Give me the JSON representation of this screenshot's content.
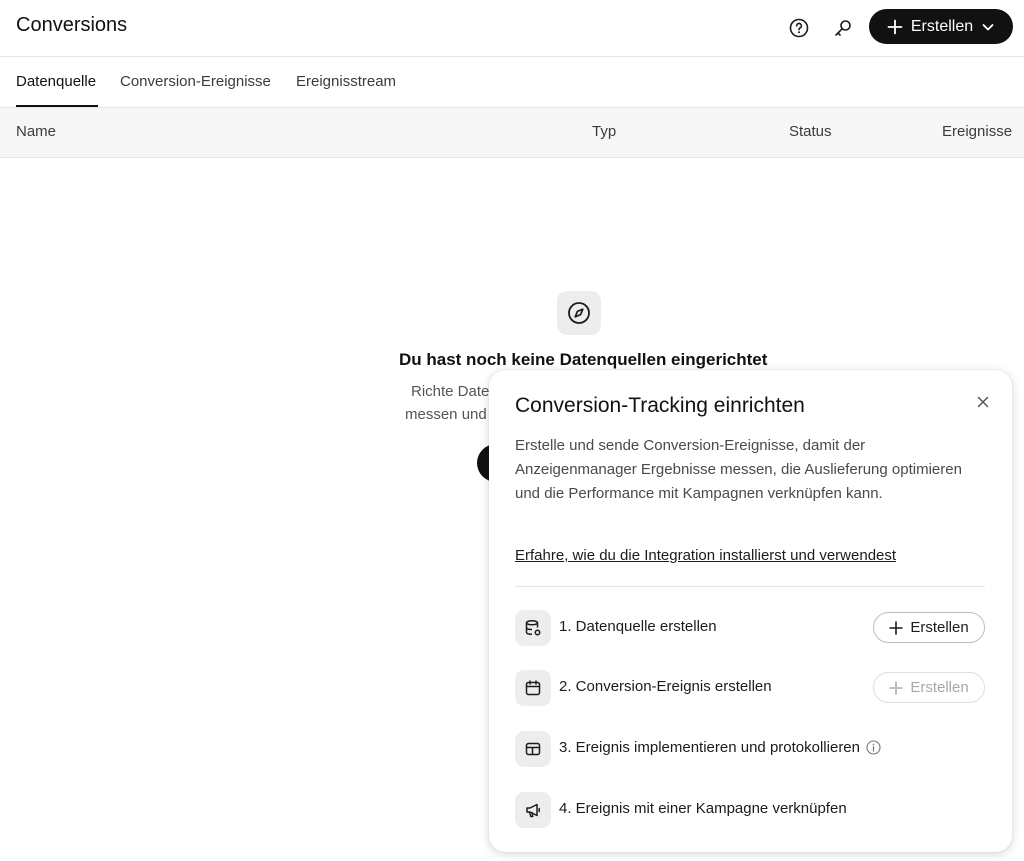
{
  "header": {
    "title": "Conversions",
    "help_icon": "help-circle-icon",
    "settings_icon": "key-icon",
    "create_label": "Erstellen"
  },
  "tabs": [
    {
      "label": "Datenquelle",
      "active": true
    },
    {
      "label": "Conversion-Ereignisse",
      "active": false
    },
    {
      "label": "Ereignisstream",
      "active": false
    }
  ],
  "table": {
    "columns": [
      "Name",
      "Typ",
      "Status",
      "Ereignisse"
    ]
  },
  "empty_state": {
    "icon": "compass-icon",
    "title": "Du hast noch keine Datenquellen eingerichtet",
    "desc_line1": "Richte Date",
    "desc_line2": "messen und"
  },
  "panel": {
    "title": "Conversion-Tracking einrichten",
    "description": "Erstelle und sende Conversion-Ereignisse, damit der Anzeigenmanager Ergebnisse messen, die Auslieferung optimieren und die Performance mit Kampagnen verknüpfen kann.",
    "link": "Erfahre, wie du die Integration installierst und verwendest",
    "steps": [
      {
        "label": "1. Datenquelle erstellen",
        "icon": "database-settings-icon",
        "button": "Erstellen",
        "enabled": true
      },
      {
        "label": "2. Conversion-Ereignis erstellen",
        "icon": "calendar-icon",
        "button": "Erstellen",
        "enabled": false
      },
      {
        "label": "3. Ereignis implementieren und protokollieren",
        "icon": "layout-icon",
        "info": true
      },
      {
        "label": "4. Ereignis mit einer Kampagne verknüpfen",
        "icon": "megaphone-icon"
      }
    ]
  }
}
